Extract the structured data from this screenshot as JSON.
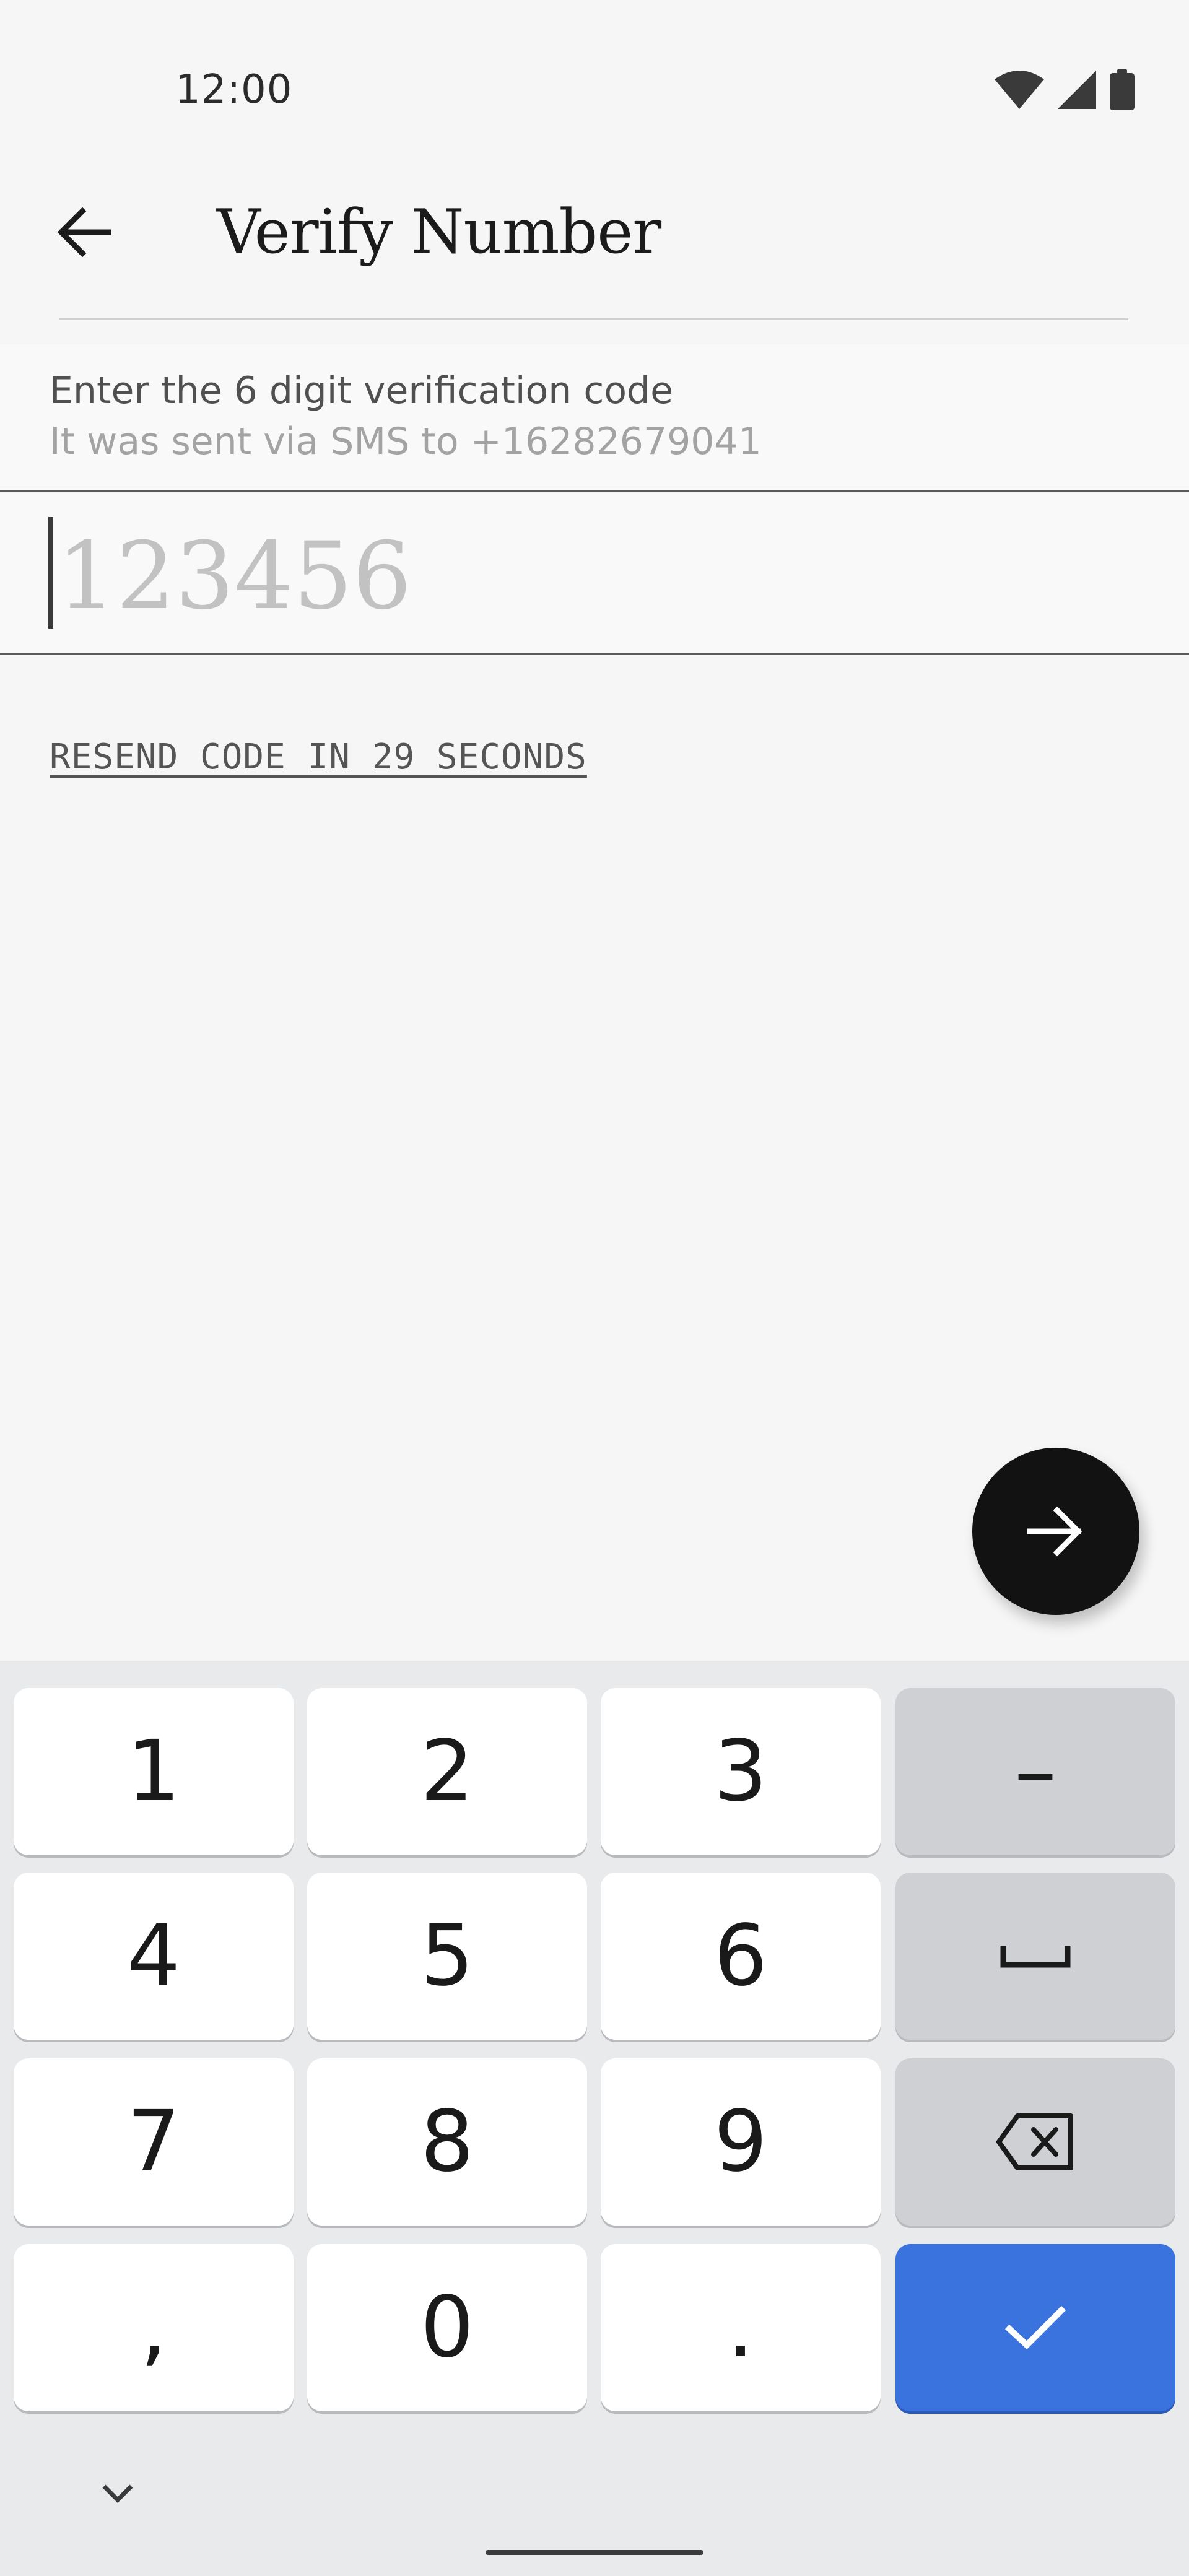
{
  "status_bar": {
    "time": "12:00",
    "icons": [
      "wifi-icon",
      "signal-icon",
      "battery-icon"
    ]
  },
  "app_bar": {
    "back_icon": "arrow-left-icon",
    "title": "Verify Number"
  },
  "instructions": {
    "line1": "Enter the 6 digit verification code",
    "line2": "It was sent via SMS to +16282679041"
  },
  "code_input": {
    "value": "",
    "placeholder": "123456"
  },
  "resend": {
    "label": "RESEND CODE IN 29 SECONDS"
  },
  "fab": {
    "icon": "arrow-right-icon"
  },
  "keyboard": {
    "keys": {
      "k1": "1",
      "k2": "2",
      "k3": "3",
      "dash": "–",
      "k4": "4",
      "k5": "5",
      "k6": "6",
      "k7": "7",
      "k8": "8",
      "k9": "9",
      "comma": ",",
      "k0": "0",
      "period": "."
    },
    "icons": [
      "space-icon",
      "backspace-icon",
      "check-icon",
      "chevron-down-icon"
    ],
    "colors": {
      "enter": "#3a73de",
      "key": "#ffffff",
      "func": "#cfd0d4"
    }
  }
}
